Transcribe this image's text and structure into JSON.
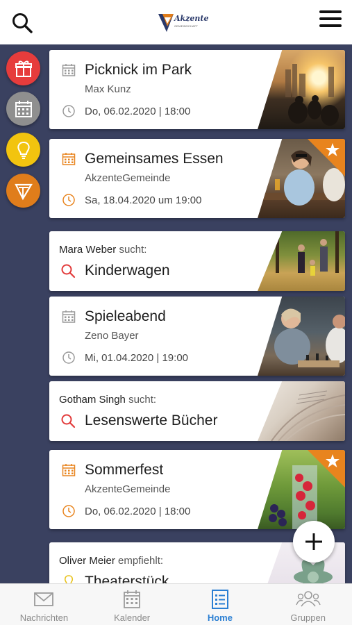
{
  "header": {
    "logo_text": "Akzente",
    "logo_sub": "GEMEINSCHAFT"
  },
  "colors": {
    "accent_orange": "#e8841e",
    "search_red": "#e23a3a",
    "dark_bg": "#3a4160",
    "active_blue": "#2b7fd3"
  },
  "sidebar": [
    {
      "icon": "gift-icon",
      "color": "#e63c3c"
    },
    {
      "icon": "calendar-icon",
      "color": "#8f8f8f"
    },
    {
      "icon": "lightbulb-icon",
      "color": "#f2c40f"
    },
    {
      "icon": "akzente-logo-icon",
      "color": "#e07d1b"
    }
  ],
  "cards": [
    {
      "type": "event",
      "title": "Picknick im Park",
      "organizer": "Max Kunz",
      "date": "Do, 06.02.2020 | 18:00",
      "highlight": false,
      "image": "park-skyline-image"
    },
    {
      "type": "event",
      "title": "Gemeinsames Essen",
      "organizer": "AkzenteGemeinde",
      "date": "Sa, 18.04.2020 um 19:00",
      "highlight": true,
      "image": "friends-eating-image"
    },
    {
      "type": "search",
      "person": "Mara Weber",
      "verb": "sucht:",
      "title": "Kinderwagen",
      "image": "family-walk-image"
    },
    {
      "type": "event",
      "title": "Spieleabend",
      "organizer": "Zeno Bayer",
      "date": "Mi, 01.04.2020 | 19:00",
      "highlight": false,
      "image": "chess-game-image"
    },
    {
      "type": "search",
      "person": "Gotham Singh",
      "verb": "sucht:",
      "title": "Lesenswerte Bücher",
      "image": "book-pages-image"
    },
    {
      "type": "event",
      "title": "Sommerfest",
      "organizer": "AkzenteGemeinde",
      "date": "Do, 06.02.2020 | 18:00",
      "highlight": true,
      "image": "fruit-drinks-image"
    },
    {
      "type": "recommend",
      "person": "Oliver Meier",
      "verb": "empfiehlt:",
      "title": "Theaterstück",
      "image": "succulent-image"
    }
  ],
  "nav": [
    {
      "label": "Nachrichten",
      "icon": "mail-icon",
      "active": false
    },
    {
      "label": "Kalender",
      "icon": "calendar-icon",
      "active": false
    },
    {
      "label": "Home",
      "icon": "home-list-icon",
      "active": true
    },
    {
      "label": "Gruppen",
      "icon": "group-icon",
      "active": false
    }
  ]
}
